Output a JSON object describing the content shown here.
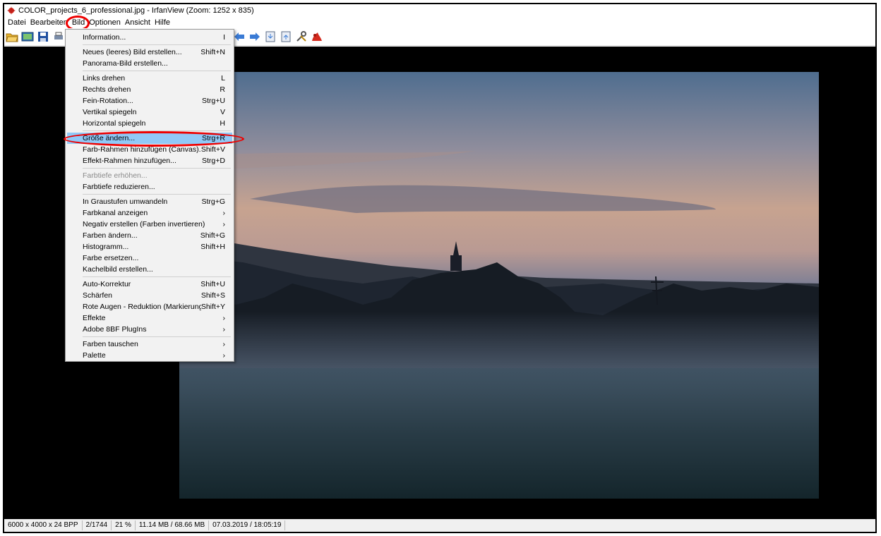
{
  "window": {
    "title": "COLOR_projects_6_professional.jpg - IrfanView (Zoom: 1252 x 835)"
  },
  "menubar": [
    "Datei",
    "Bearbeiten",
    "Bild",
    "Optionen",
    "Ansicht",
    "Hilfe"
  ],
  "toolbar": {
    "icons": [
      "open-folder-icon",
      "slideshow-icon",
      "save-icon",
      "print-icon",
      "prev-arrow-icon",
      "next-arrow-icon",
      "copy-icon",
      "paste-icon",
      "settings-icon",
      "irfanview-logo-icon"
    ]
  },
  "bild_menu": {
    "items": [
      {
        "label": "Information...",
        "shortcut": "I"
      },
      {
        "label": "Neues (leeres) Bild erstellen...",
        "shortcut": "Shift+N"
      },
      {
        "label": "Panorama-Bild erstellen...",
        "shortcut": ""
      },
      {
        "label": "Links drehen",
        "shortcut": "L"
      },
      {
        "label": "Rechts drehen",
        "shortcut": "R"
      },
      {
        "label": "Fein-Rotation...",
        "shortcut": "Strg+U"
      },
      {
        "label": "Vertikal spiegeln",
        "shortcut": "V"
      },
      {
        "label": "Horizontal spiegeln",
        "shortcut": "H"
      },
      {
        "label": "Größe ändern...",
        "shortcut": "Strg+R",
        "highlighted": true
      },
      {
        "label": "Farb-Rahmen hinzufügen (Canvas)...",
        "shortcut": "Shift+V"
      },
      {
        "label": "Effekt-Rahmen hinzufügen...",
        "shortcut": "Strg+D"
      },
      {
        "label": "Farbtiefe erhöhen...",
        "shortcut": "",
        "disabled": true
      },
      {
        "label": "Farbtiefe reduzieren...",
        "shortcut": ""
      },
      {
        "label": "In Graustufen umwandeln",
        "shortcut": "Strg+G"
      },
      {
        "label": "Farbkanal anzeigen",
        "shortcut": "›"
      },
      {
        "label": "Negativ erstellen (Farben invertieren)",
        "shortcut": "›"
      },
      {
        "label": "Farben ändern...",
        "shortcut": "Shift+G"
      },
      {
        "label": "Histogramm...",
        "shortcut": "Shift+H"
      },
      {
        "label": "Farbe ersetzen...",
        "shortcut": ""
      },
      {
        "label": "Kachelbild erstellen...",
        "shortcut": ""
      },
      {
        "label": "Auto-Korrektur",
        "shortcut": "Shift+U"
      },
      {
        "label": "Schärfen",
        "shortcut": "Shift+S"
      },
      {
        "label": "Rote Augen - Reduktion (Markierung)",
        "shortcut": "Shift+Y"
      },
      {
        "label": "Effekte",
        "shortcut": "›"
      },
      {
        "label": "Adobe 8BF PlugIns",
        "shortcut": "›"
      },
      {
        "label": "Farben tauschen",
        "shortcut": "›"
      },
      {
        "label": "Palette",
        "shortcut": "›"
      }
    ]
  },
  "statusbar": [
    "6000 x 4000 x 24 BPP",
    "2/1744",
    "21 %",
    "11.14 MB / 68.66 MB",
    "07.03.2019 / 18:05:19"
  ],
  "colors": {
    "highlight": "#91c9f7",
    "annotation": "#e00000"
  }
}
